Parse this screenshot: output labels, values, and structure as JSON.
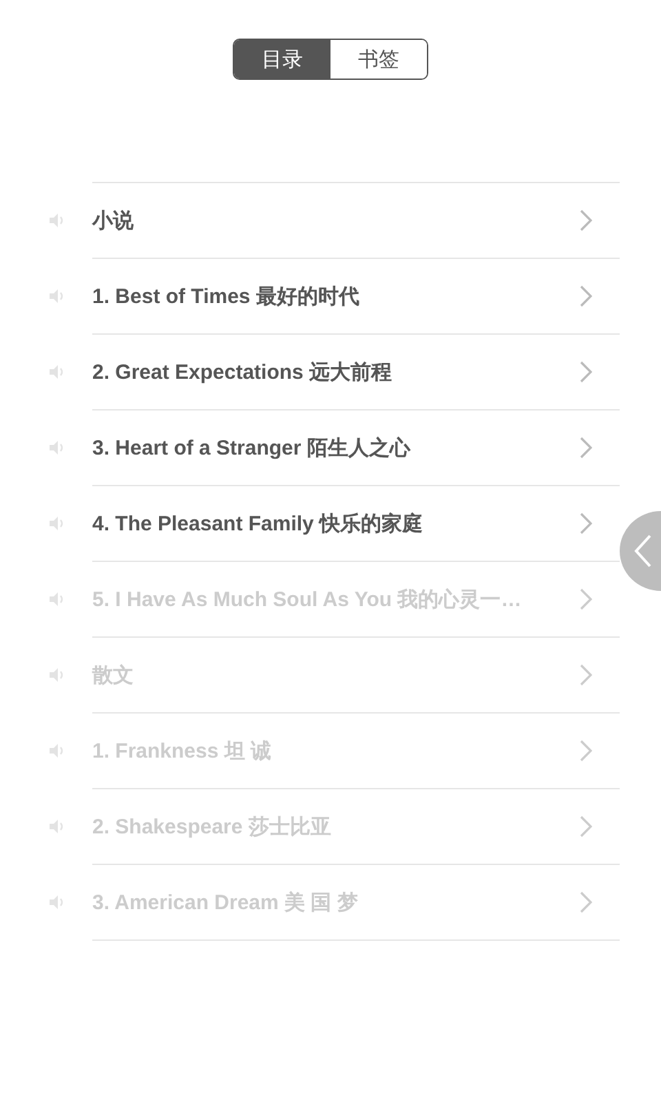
{
  "tabs": [
    {
      "label": "目录",
      "selected": true
    },
    {
      "label": "书签",
      "selected": false
    }
  ],
  "chapters": [
    {
      "title": "小说",
      "disabled": false
    },
    {
      "title": "1. Best of Times 最好的时代",
      "disabled": false
    },
    {
      "title": "2. Great Expectations 远大前程",
      "disabled": false
    },
    {
      "title": "3. Heart of a Stranger 陌生人之心",
      "disabled": false
    },
    {
      "title": "4. The Pleasant Family 快乐的家庭",
      "disabled": false
    },
    {
      "title": "5. I Have As Much Soul As You 我的心灵一…",
      "disabled": true
    },
    {
      "title": "散文",
      "disabled": true
    },
    {
      "title": "1. Frankness 坦 诚",
      "disabled": true
    },
    {
      "title": "2. Shakespeare 莎士比亚",
      "disabled": true
    },
    {
      "title": "3. American Dream 美 国 梦",
      "disabled": true
    }
  ]
}
